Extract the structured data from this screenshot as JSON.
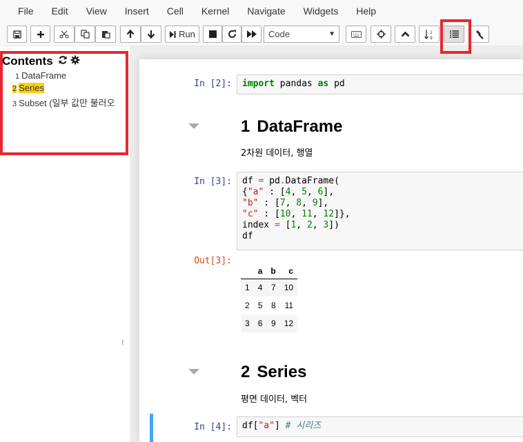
{
  "menu": [
    "File",
    "Edit",
    "View",
    "Insert",
    "Cell",
    "Kernel",
    "Navigate",
    "Widgets",
    "Help"
  ],
  "toolbar": {
    "run_label": "Run",
    "cell_type": "Code",
    "icons": [
      "save-icon",
      "plus-icon",
      "cut-icon",
      "copy-icon",
      "paste-icon",
      "arrow-up-icon",
      "arrow-down-icon",
      "run-icon",
      "stop-icon",
      "restart-icon",
      "fast-forward-icon",
      "keyboard-icon",
      "crosshair-icon",
      "chevron-up-icon",
      "sort-numeric-icon",
      "list-icon",
      "gavel-icon"
    ]
  },
  "toc": {
    "title": "Contents",
    "items": [
      {
        "num": "1",
        "text": "DataFrame"
      },
      {
        "num": "2",
        "text": "Series"
      },
      {
        "num": "3",
        "text": "Subset (일부 값만 불러오"
      }
    ]
  },
  "cells": {
    "c2": {
      "prompt": "In [2]:"
    },
    "h1": {
      "num": "1",
      "text": "DataFrame"
    },
    "p1": "2차원 데이터, 행열",
    "c3": {
      "prompt": "In [3]:",
      "out_prompt": "Out[3]:"
    },
    "h2": {
      "num": "2",
      "text": "Series"
    },
    "p2": "평면 데이터, 벡터",
    "c4": {
      "prompt": "In [4]:"
    }
  },
  "dataframe": {
    "columns": [
      "",
      "a",
      "b",
      "c"
    ],
    "rows": [
      [
        "1",
        "4",
        "7",
        "10"
      ],
      [
        "2",
        "5",
        "8",
        "11"
      ],
      [
        "3",
        "6",
        "9",
        "12"
      ]
    ]
  },
  "colors": {
    "highlight": "#fdd212",
    "annotation": "#e8262f",
    "selected": "#42a5f5"
  }
}
